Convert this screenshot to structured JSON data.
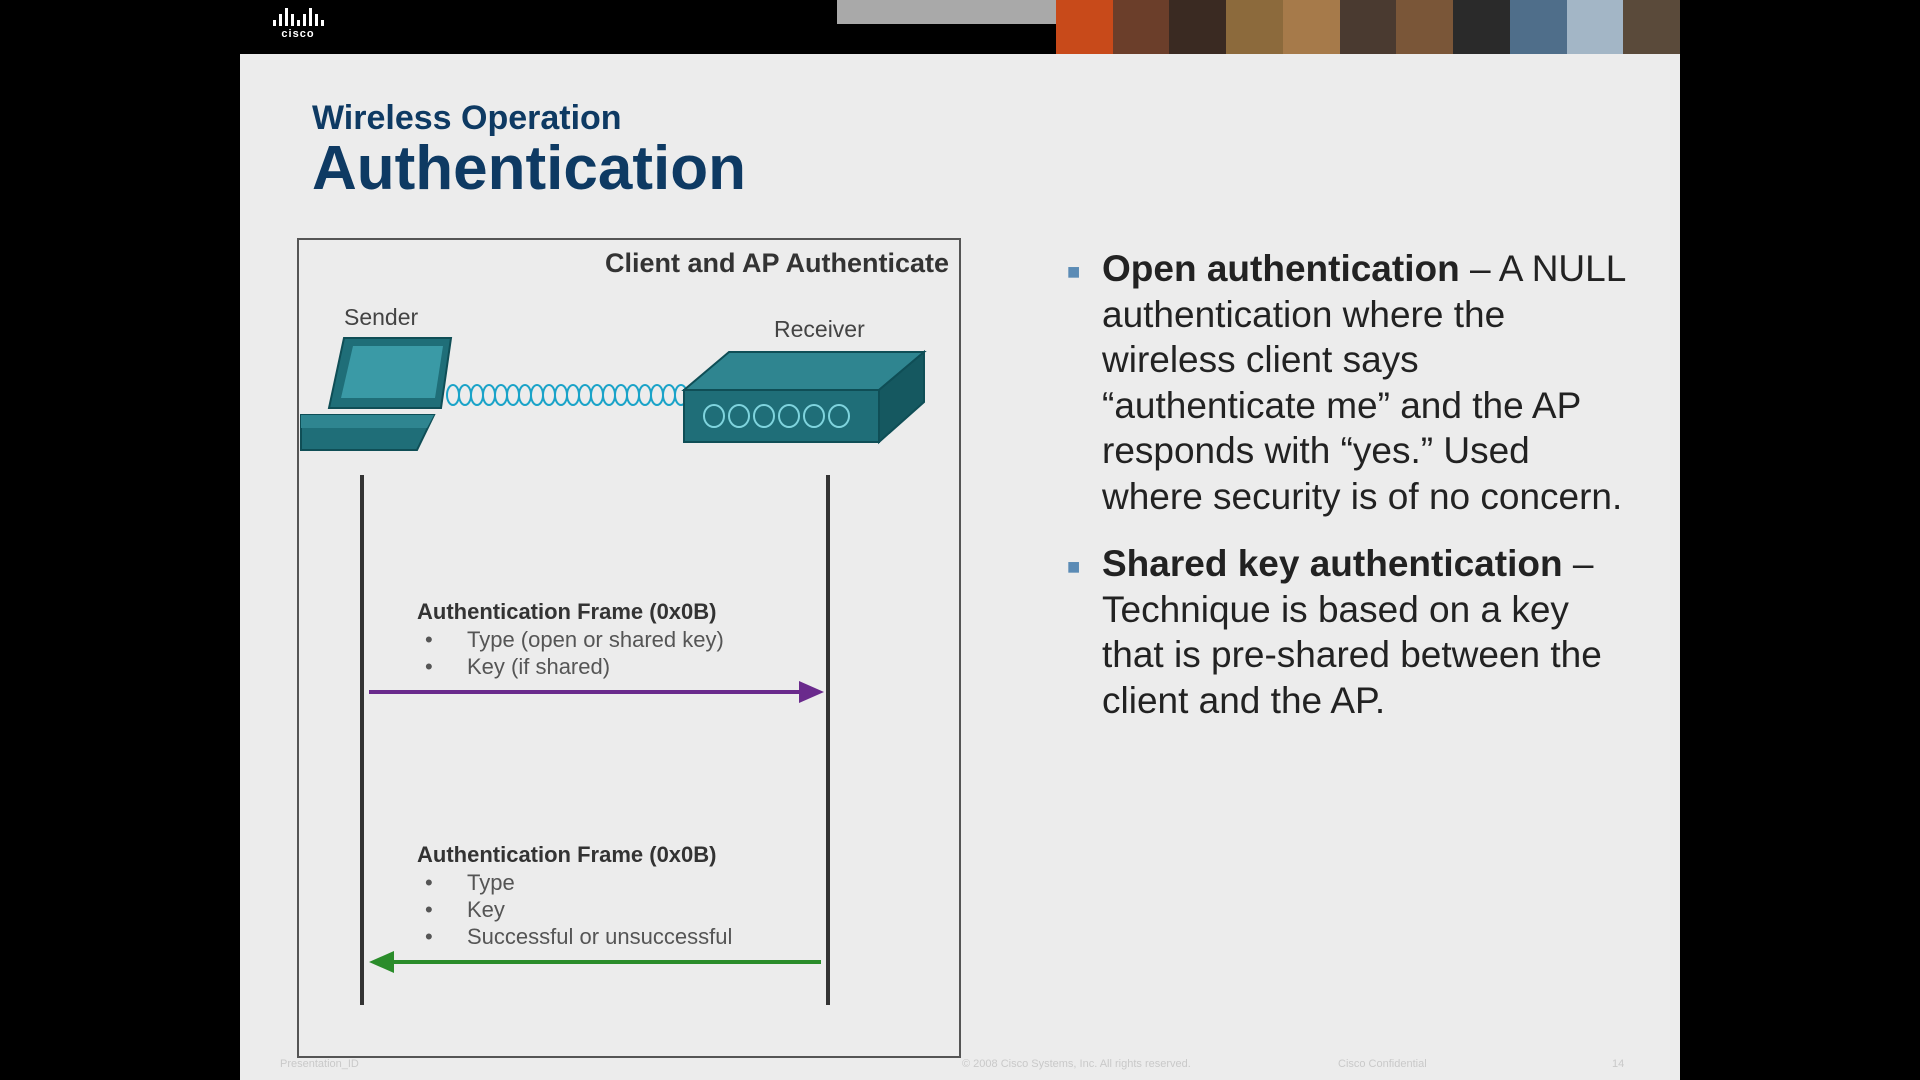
{
  "header": {
    "logo_text": "cisco",
    "subtitle": "Wireless Operation",
    "title": "Authentication",
    "photo_colors": [
      "#c84a1a",
      "#6b3e2a",
      "#3a2a22",
      "#8c6a3c",
      "#a67a4a",
      "#4a3a30",
      "#7a5638",
      "#2a2a2a",
      "#4f6e8a",
      "#a3b6c6",
      "#5a4a3a"
    ]
  },
  "diagram": {
    "title": "Client and AP Authenticate",
    "sender_label": "Sender",
    "receiver_label": "Receiver",
    "frame1": {
      "title": "Authentication Frame (0x0B)",
      "items": [
        "Type (open or shared key)",
        "Key (if shared)"
      ],
      "arrow_color": "#6a2a8c"
    },
    "frame2": {
      "title": "Authentication Frame (0x0B)",
      "items": [
        "Type",
        "Key",
        "Successful or unsuccessful"
      ],
      "arrow_color": "#2a8c2a"
    },
    "device_color": "#1f6e78"
  },
  "bullets": [
    {
      "heading": "Open authentication",
      "text": " – A NULL authentication where the wireless client says “authenticate me” and the AP responds with “yes.” Used where security is of no concern."
    },
    {
      "heading": "Shared key authentication",
      "text": " – Technique is based on a key that is pre-shared between the client and the AP."
    }
  ],
  "footer": {
    "left": "Presentation_ID",
    "center": "© 2008 Cisco Systems, Inc. All rights reserved.",
    "confidential": "Cisco Confidential",
    "page_number": "14"
  }
}
